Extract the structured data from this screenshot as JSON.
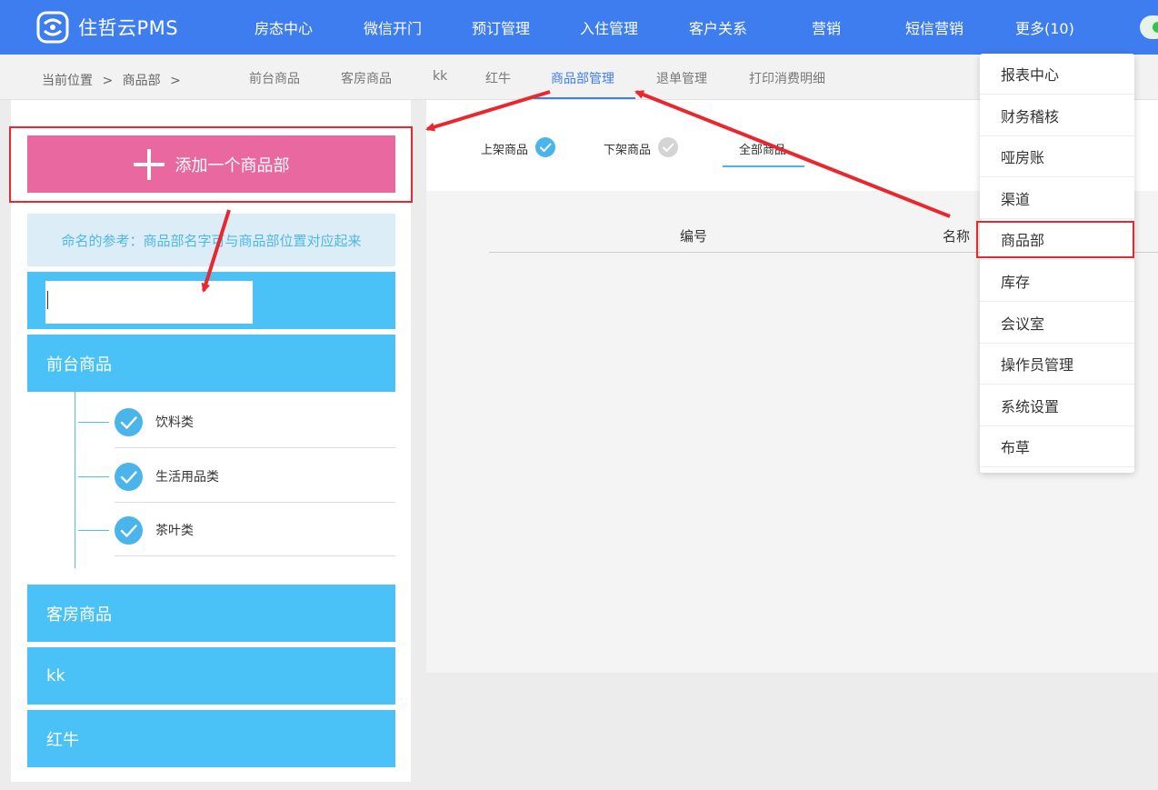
{
  "app": {
    "logo_text": "住哲云PMS"
  },
  "nav": [
    {
      "label": "房态中心"
    },
    {
      "label": "微信开门"
    },
    {
      "label": "预订管理"
    },
    {
      "label": "入住管理"
    },
    {
      "label": "客户关系"
    },
    {
      "label": "营销"
    },
    {
      "label": "短信营销"
    },
    {
      "label": "更多(10)"
    }
  ],
  "breadcrumb": {
    "prefix": "当前位置",
    "sep": ">",
    "current": "商品部"
  },
  "subtabs": [
    {
      "label": "前台商品"
    },
    {
      "label": "客房商品"
    },
    {
      "label": "kk"
    },
    {
      "label": "红牛"
    },
    {
      "label": "商品部管理",
      "active": true
    },
    {
      "label": "退单管理"
    },
    {
      "label": "打印消费明细"
    }
  ],
  "left": {
    "add_button": "添加一个商品部",
    "hint": "命名的参考：商品部名字可与商品部位置对应起来",
    "name_input": {
      "value": "",
      "placeholder": ""
    },
    "categories": [
      {
        "label": "前台商品"
      },
      {
        "label": "客房商品"
      },
      {
        "label": "kk"
      },
      {
        "label": "红牛"
      }
    ],
    "subitems": [
      {
        "label": "饮料类"
      },
      {
        "label": "生活用品类"
      },
      {
        "label": "茶叶类"
      }
    ]
  },
  "content": {
    "filters": [
      {
        "label": "上架商品",
        "checked": true
      },
      {
        "label": "下架商品",
        "checked": false
      },
      {
        "label": "全部商品",
        "active": true
      }
    ],
    "columns": [
      {
        "label": "编号"
      },
      {
        "label": "名称"
      }
    ]
  },
  "dropdown": {
    "items": [
      {
        "label": "报表中心"
      },
      {
        "label": "财务稽核"
      },
      {
        "label": "哑房账"
      },
      {
        "label": "渠道"
      },
      {
        "label": "商品部",
        "highlighted": true
      },
      {
        "label": "库存"
      },
      {
        "label": "会议室"
      },
      {
        "label": "操作员管理"
      },
      {
        "label": "系统设置"
      },
      {
        "label": "布草"
      }
    ]
  },
  "colors": {
    "topbar": "#3d7df0",
    "accent_pink": "#e9689f",
    "accent_blue": "#4bc2f7",
    "annotation_red": "#e8282e"
  }
}
